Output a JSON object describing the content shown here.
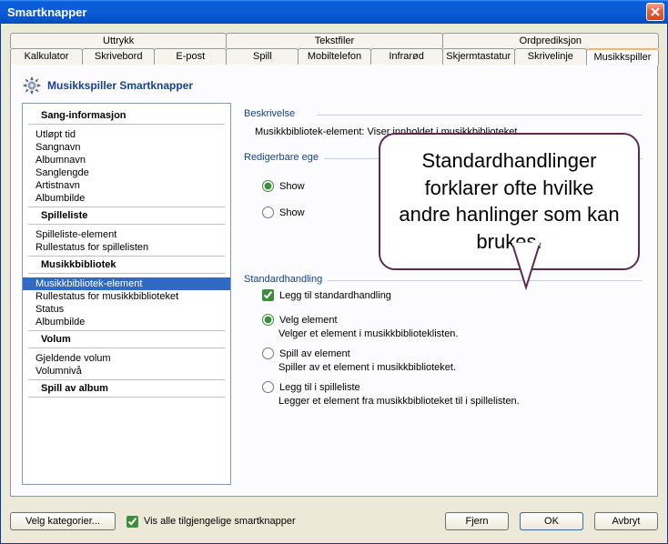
{
  "window": {
    "title": "Smartknapper"
  },
  "tabs_row1": [
    "Uttrykk",
    "Tekstfiler",
    "Ordprediksjon"
  ],
  "tabs_row2": [
    "Kalkulator",
    "Skrivebord",
    "E-post",
    "Spill",
    "Mobiltelefon",
    "Infrarød",
    "Skjermtastatur",
    "Skrivelinje",
    "Musikkspiller"
  ],
  "active_tab": "Musikkspiller",
  "page_title": "Musikkspiller Smartknapper",
  "tree": [
    {
      "type": "cat",
      "label": "Sang-informasjon"
    },
    {
      "type": "item",
      "label": "Utløpt tid"
    },
    {
      "type": "item",
      "label": "Sangnavn"
    },
    {
      "type": "item",
      "label": "Albumnavn"
    },
    {
      "type": "item",
      "label": "Sanglengde"
    },
    {
      "type": "item",
      "label": "Artistnavn"
    },
    {
      "type": "item",
      "label": "Albumbilde"
    },
    {
      "type": "cat",
      "label": "Spilleliste"
    },
    {
      "type": "item",
      "label": "Spilleliste-element"
    },
    {
      "type": "item",
      "label": "Rullestatus for spillelisten"
    },
    {
      "type": "cat",
      "label": "Musikkbibliotek"
    },
    {
      "type": "item",
      "label": "Musikkbibliotek-element",
      "selected": true
    },
    {
      "type": "item",
      "label": "Rullestatus for musikkbiblioteket"
    },
    {
      "type": "item",
      "label": "Status"
    },
    {
      "type": "item",
      "label": "Albumbilde"
    },
    {
      "type": "cat",
      "label": "Volum"
    },
    {
      "type": "item",
      "label": "Gjeldende volum"
    },
    {
      "type": "item",
      "label": "Volumnivå"
    },
    {
      "type": "cat",
      "label": "Spill av album"
    }
  ],
  "description": {
    "heading": "Beskrivelse",
    "text": "Musikkbibliotek-element: Viser innholdet i musikkbiblioteket"
  },
  "editable": {
    "heading": "Redigerbare ege",
    "radio1_prefix": "Show",
    "radio2_prefix": "Show"
  },
  "default_action": {
    "heading": "Standardhandling",
    "check_label": "Legg til standardhandling",
    "opt1": {
      "title": "Velg element",
      "desc": "Velger et element i musikkbiblioteklisten."
    },
    "opt2": {
      "title": "Spill av element",
      "desc": "Spiller av et element i musikkbiblioteket."
    },
    "opt3": {
      "title": "Legg til i spilleliste",
      "desc": "Legger et element fra musikkbiblioteket til i spillelisten."
    }
  },
  "callout": "Standardhandlinger forklarer ofte hvilke andre hanlinger som kan brukes.",
  "buttons": {
    "categories": "Velg kategorier...",
    "show_all": "Vis alle tilgjengelige smartknapper",
    "clear": "Fjern",
    "ok": "OK",
    "cancel": "Avbryt"
  }
}
